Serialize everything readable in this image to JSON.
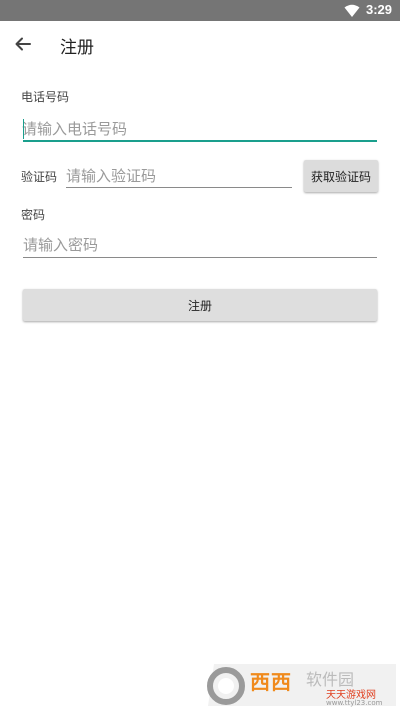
{
  "status_bar": {
    "time": "3:29",
    "wifi_icon": "wifi-icon"
  },
  "app_bar": {
    "title": "注册",
    "back_icon": "arrow-back-icon"
  },
  "form": {
    "phone": {
      "label": "电话号码",
      "placeholder": "请输入电话号码"
    },
    "code": {
      "label": "验证码",
      "placeholder": "请输入验证码",
      "button_label": "获取验证码"
    },
    "password": {
      "label": "密码",
      "placeholder": "请输入密码"
    },
    "submit_label": "注册"
  },
  "watermark": {
    "brand": "西西",
    "brand_suffix": "软件园",
    "site_name": "天天游戏网",
    "site_url": "www.ttyl23.com"
  },
  "colors": {
    "accent": "#1a9f8d",
    "status_bar": "#757575",
    "button": "#dedede"
  }
}
